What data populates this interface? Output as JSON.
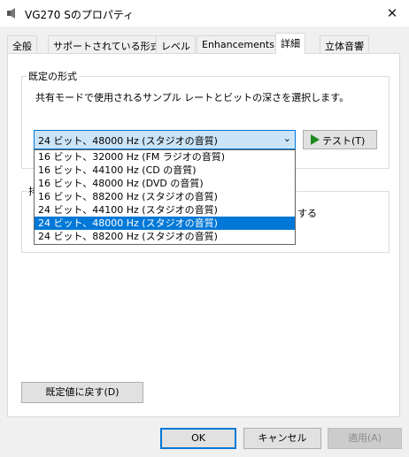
{
  "window": {
    "title": "VG270 Sのプロパティ",
    "close_symbol": "✕"
  },
  "tabs": [
    {
      "label": "全般"
    },
    {
      "label": "サポートされている形式"
    },
    {
      "label": "レベル"
    },
    {
      "label": "Enhancements"
    },
    {
      "label": "詳細"
    },
    {
      "label": "立体音響"
    }
  ],
  "default_format": {
    "group_label": "既定の形式",
    "description": "共有モードで使用されるサンプル レートとビットの深さを選択します。",
    "selected_value": "24 ビット、48000 Hz (スタジオの音質)",
    "test_button_label": "テスト(T)",
    "options": [
      "16 ビット、32000 Hz (FM ラジオの音質)",
      "16 ビット、44100 Hz (CD の音質)",
      "16 ビット、48000 Hz (DVD の音質)",
      "16 ビット、88200 Hz (スタジオの音質)",
      "24 ビット、44100 Hz (スタジオの音質)",
      "24 ビット、48000 Hz (スタジオの音質)",
      "24 ビット、88200 Hz (スタジオの音質)"
    ],
    "highlighted_index": 5
  },
  "exclusive_mode": {
    "group_label_visible": "排",
    "partial_text": "する"
  },
  "buttons": {
    "restore_defaults": "既定値に戻す(D)",
    "ok": "OK",
    "cancel": "キャンセル",
    "apply": "適用(A)"
  },
  "colors": {
    "accent": "#0078d7",
    "selection_bg": "#cce4f7",
    "play_icon": "#1f8a1f"
  }
}
